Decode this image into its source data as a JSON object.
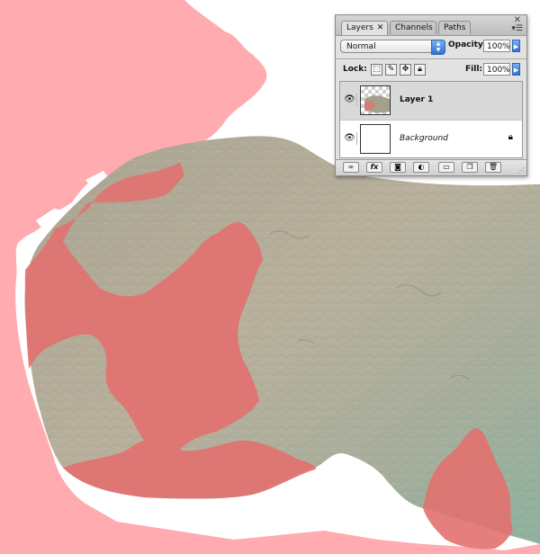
{
  "layers_panel": {
    "tabs": [
      {
        "label": "Layers",
        "active": true
      },
      {
        "label": "Channels",
        "active": false
      },
      {
        "label": "Paths",
        "active": false
      }
    ],
    "tab_close_glyph": "✕",
    "blend_mode": "Normal",
    "opacity_label": "Opacity:",
    "opacity_value": "100%",
    "lock_label": "Lock:",
    "fill_label": "Fill:",
    "fill_value": "100%",
    "layers": [
      {
        "name": "Layer 1",
        "selected": true,
        "visible": true
      },
      {
        "name": "Background",
        "selected": false,
        "visible": true,
        "locked": true
      }
    ],
    "footer_icons": [
      "link-layers-icon",
      "fx-icon",
      "layer-mask-icon",
      "adjustment-layer-icon",
      "new-group-icon",
      "new-layer-icon",
      "trash-icon"
    ]
  },
  "colors": {
    "overlay_pink": "#ffabb0",
    "overlay_red": "#e2716f",
    "terrain": "#b2ab98",
    "terrain_green": "#8eae9e",
    "highlight_blue": "#2f6fd6"
  }
}
